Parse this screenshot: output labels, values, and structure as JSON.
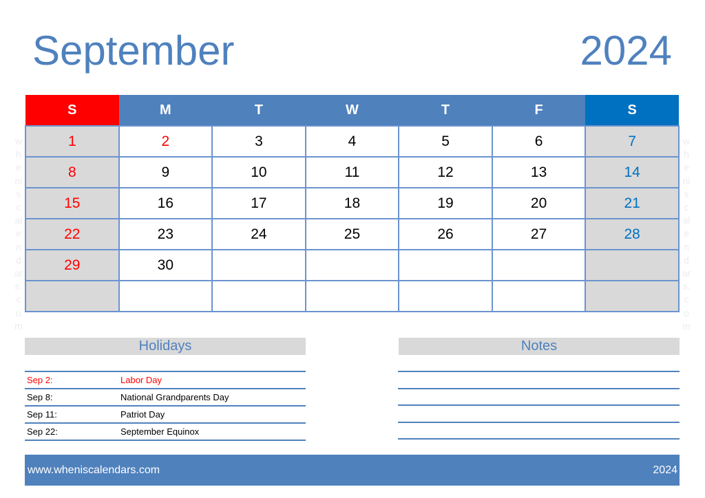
{
  "header": {
    "month": "September",
    "year": "2024"
  },
  "weekdays": [
    "S",
    "M",
    "T",
    "W",
    "T",
    "F",
    "S"
  ],
  "weeks": [
    [
      "",
      "",
      "",
      "",
      "",
      "",
      ""
    ]
  ],
  "calendar": {
    "rows": [
      [
        {
          "d": "1",
          "c": "red"
        },
        {
          "d": "2",
          "c": "red"
        },
        {
          "d": "3",
          "c": ""
        },
        {
          "d": "4",
          "c": ""
        },
        {
          "d": "5",
          "c": ""
        },
        {
          "d": "6",
          "c": ""
        },
        {
          "d": "7",
          "c": "blue"
        }
      ],
      [
        {
          "d": "8",
          "c": "red"
        },
        {
          "d": "9",
          "c": ""
        },
        {
          "d": "10",
          "c": ""
        },
        {
          "d": "11",
          "c": ""
        },
        {
          "d": "12",
          "c": ""
        },
        {
          "d": "13",
          "c": ""
        },
        {
          "d": "14",
          "c": "blue"
        }
      ],
      [
        {
          "d": "15",
          "c": "red"
        },
        {
          "d": "16",
          "c": ""
        },
        {
          "d": "17",
          "c": ""
        },
        {
          "d": "18",
          "c": ""
        },
        {
          "d": "19",
          "c": ""
        },
        {
          "d": "20",
          "c": ""
        },
        {
          "d": "21",
          "c": "blue"
        }
      ],
      [
        {
          "d": "22",
          "c": "red"
        },
        {
          "d": "23",
          "c": ""
        },
        {
          "d": "24",
          "c": ""
        },
        {
          "d": "25",
          "c": ""
        },
        {
          "d": "26",
          "c": ""
        },
        {
          "d": "27",
          "c": ""
        },
        {
          "d": "28",
          "c": "blue"
        }
      ],
      [
        {
          "d": "29",
          "c": "red"
        },
        {
          "d": "30",
          "c": ""
        },
        {
          "d": "",
          "c": ""
        },
        {
          "d": "",
          "c": ""
        },
        {
          "d": "",
          "c": ""
        },
        {
          "d": "",
          "c": ""
        },
        {
          "d": "",
          "c": ""
        }
      ],
      [
        {
          "d": "",
          "c": ""
        },
        {
          "d": "",
          "c": ""
        },
        {
          "d": "",
          "c": ""
        },
        {
          "d": "",
          "c": ""
        },
        {
          "d": "",
          "c": ""
        },
        {
          "d": "",
          "c": ""
        },
        {
          "d": "",
          "c": ""
        }
      ]
    ]
  },
  "watermark": [
    "w",
    "h",
    "e",
    "ni",
    "s",
    "c",
    "al",
    "e",
    "n",
    "d",
    "ar",
    "s.",
    "c",
    "o",
    "m"
  ],
  "holidays": {
    "title": "Holidays",
    "items": [
      {
        "date": "Sep 2:",
        "name": "Labor Day",
        "highlight": true
      },
      {
        "date": "Sep 8:",
        "name": "National Grandparents Day",
        "highlight": false
      },
      {
        "date": "Sep 11:",
        "name": "Patriot Day",
        "highlight": false
      },
      {
        "date": "Sep 22:",
        "name": "September Equinox",
        "highlight": false
      }
    ]
  },
  "notes": {
    "title": "Notes",
    "line_count": 5
  },
  "footer": {
    "url": "www.wheniscalendars.com",
    "year": "2024"
  },
  "colors": {
    "accent": "#4f81bd",
    "sunday": "#ff0000",
    "saturday": "#0070c0",
    "weekend_bg": "#d9d9d9"
  }
}
